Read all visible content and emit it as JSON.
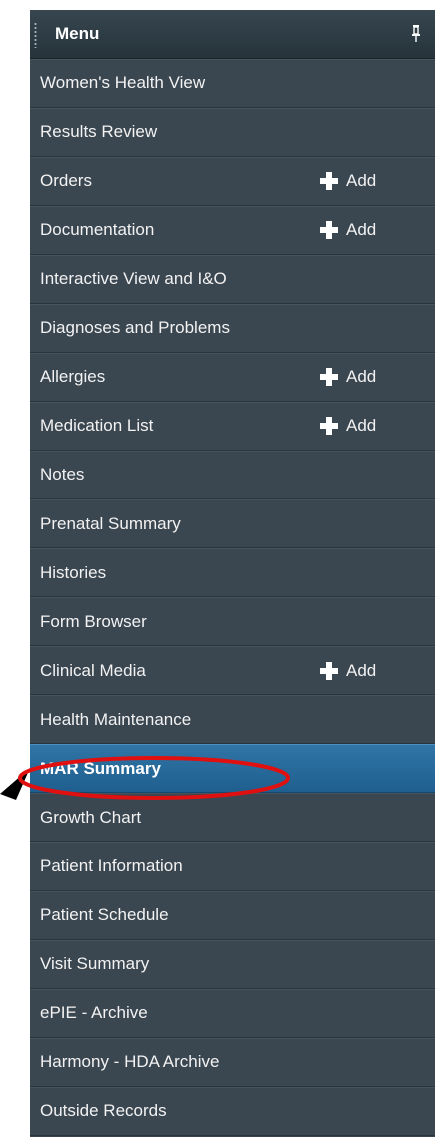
{
  "menu": {
    "title": "Menu",
    "pin_icon": "pin-icon",
    "items": [
      {
        "label": "Women's Health View",
        "add": null
      },
      {
        "label": "Results Review",
        "add": null
      },
      {
        "label": "Orders",
        "add": "Add"
      },
      {
        "label": "Documentation",
        "add": "Add"
      },
      {
        "label": "Interactive View and I&O",
        "add": null
      },
      {
        "label": "Diagnoses and Problems",
        "add": null
      },
      {
        "label": "Allergies",
        "add": "Add"
      },
      {
        "label": "Medication List",
        "add": "Add"
      },
      {
        "label": "Notes",
        "add": null
      },
      {
        "label": "Prenatal Summary",
        "add": null
      },
      {
        "label": "Histories",
        "add": null
      },
      {
        "label": "Form Browser",
        "add": null
      },
      {
        "label": "Clinical Media",
        "add": "Add"
      },
      {
        "label": "Health Maintenance",
        "add": null
      },
      {
        "label": "MAR Summary",
        "add": null,
        "selected": true
      },
      {
        "label": "Growth Chart",
        "add": null
      },
      {
        "label": "Patient Information",
        "add": null
      },
      {
        "label": "Patient Schedule",
        "add": null
      },
      {
        "label": "Visit Summary",
        "add": null
      },
      {
        "label": "ePIE - Archive",
        "add": null
      },
      {
        "label": "Harmony - HDA Archive",
        "add": null
      },
      {
        "label": "Outside Records",
        "add": null
      }
    ]
  },
  "colors": {
    "panel_bg": "#3a4650",
    "header_bg": "#26333b",
    "selected_bg": "#2a6b9c",
    "text": "#f2f2f2",
    "annotation_red": "#e01010",
    "annotation_arrow": "#000000"
  },
  "annotation": {
    "highlighted_item": "MAR Summary",
    "arrow_icon": "arrow-pointer-icon",
    "circle": "red-ellipse-highlight"
  }
}
